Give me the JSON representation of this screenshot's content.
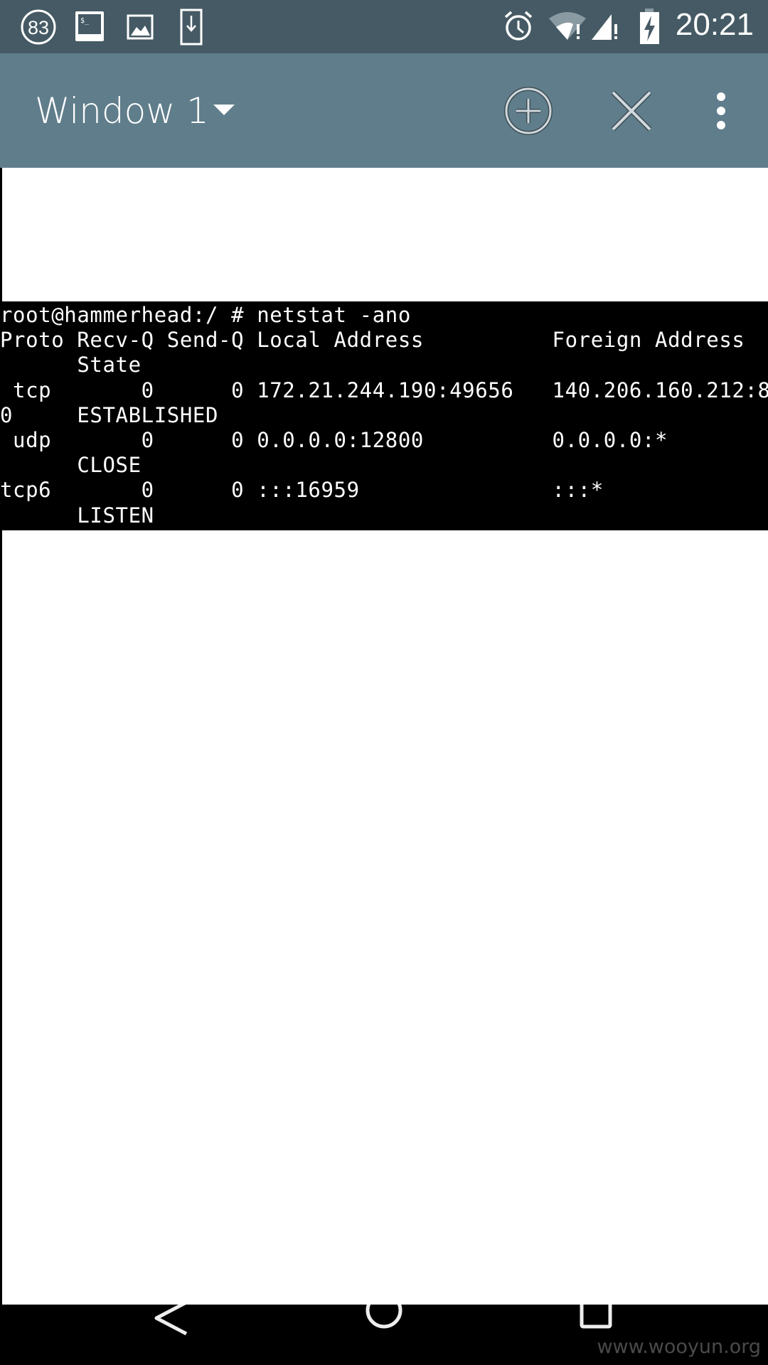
{
  "status_bar": {
    "notification_count": "83",
    "icons": [
      "notification-count-icon",
      "terminal-icon",
      "image-icon",
      "download-icon",
      "alarm-icon",
      "wifi-icon",
      "signal-icon",
      "battery-charging-icon"
    ],
    "time": "20:21"
  },
  "toolbar": {
    "window_title": "Window 1",
    "new_window_icon": "plus-circle-icon",
    "close_window_icon": "close-icon",
    "menu_icon": "more-vert-icon"
  },
  "terminal": {
    "lines": [
      "root@hammerhead:/ # netstat -ano",
      "Proto Recv-Q Send-Q Local Address          Foreign Address",
      "      State",
      " tcp       0      0 172.21.244.190:49656   140.206.160.212:8",
      "0     ESTABLISHED",
      " udp       0      0 0.0.0.0:12800          0.0.0.0:*",
      "      CLOSE",
      "tcp6       0      0 :::16959               :::*",
      "      LISTEN"
    ]
  },
  "watermark": "www.wooyun.org",
  "colors": {
    "status_bar": "#455A64",
    "toolbar": "#607D8B",
    "terminal_bg": "#000000",
    "terminal_fg": "#FFFFFF"
  }
}
